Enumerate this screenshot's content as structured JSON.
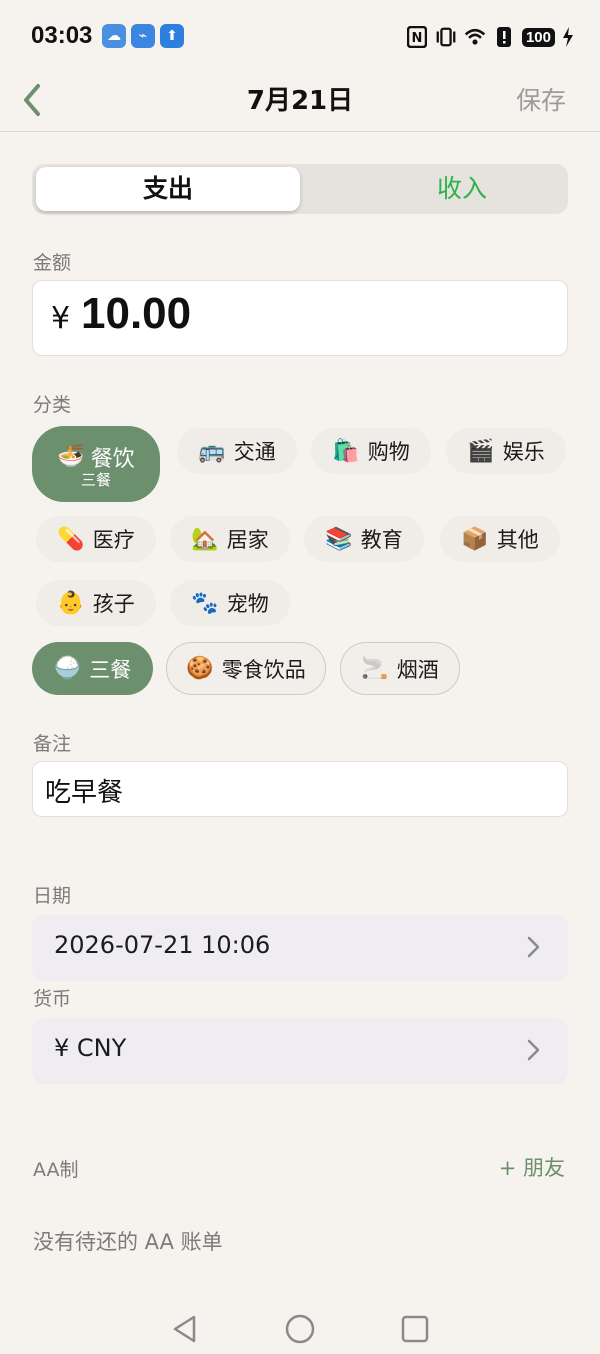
{
  "status_bar": {
    "time": "03:03",
    "app_icons": [
      "weather-icon",
      "usb-icon",
      "upload-icon"
    ],
    "battery": "100"
  },
  "header": {
    "title": "7月21日",
    "save_label": "保存"
  },
  "type_toggle": {
    "expense_label": "支出",
    "income_label": "收入",
    "selected": "支出",
    "income_color": "#2bb449"
  },
  "amount": {
    "label": "金额",
    "currency_symbol": "¥",
    "value": "10.00"
  },
  "category": {
    "label": "分类",
    "main_items": [
      {
        "emoji": "🍜",
        "label": "餐饮",
        "sub": "三餐",
        "selected": true
      },
      {
        "emoji": "🚌",
        "label": "交通"
      },
      {
        "emoji": "🛍️",
        "label": "购物"
      },
      {
        "emoji": "🎬",
        "label": "娱乐"
      },
      {
        "emoji": "💊",
        "label": "医疗"
      },
      {
        "emoji": "🏡",
        "label": "居家"
      },
      {
        "emoji": "📚",
        "label": "教育"
      },
      {
        "emoji": "📦",
        "label": "其他"
      },
      {
        "emoji": "👶",
        "label": "孩子"
      },
      {
        "emoji": "🐾",
        "label": "宠物"
      }
    ],
    "sub_items": [
      {
        "emoji": "🍚",
        "label": "三餐",
        "selected": true
      },
      {
        "emoji": "🍪",
        "label": "零食饮品"
      },
      {
        "emoji": "🚬",
        "label": "烟酒"
      }
    ],
    "selected_color": "#6c8f6e"
  },
  "note": {
    "label": "备注",
    "value": "吃早餐"
  },
  "date": {
    "label": "日期",
    "value": "2026-07-21  10:06"
  },
  "currency": {
    "label": "货币",
    "value": "¥  CNY"
  },
  "aa": {
    "label": "AA制",
    "add_label": "+ 朋友",
    "empty_text": "没有待还的 AA 账单"
  }
}
